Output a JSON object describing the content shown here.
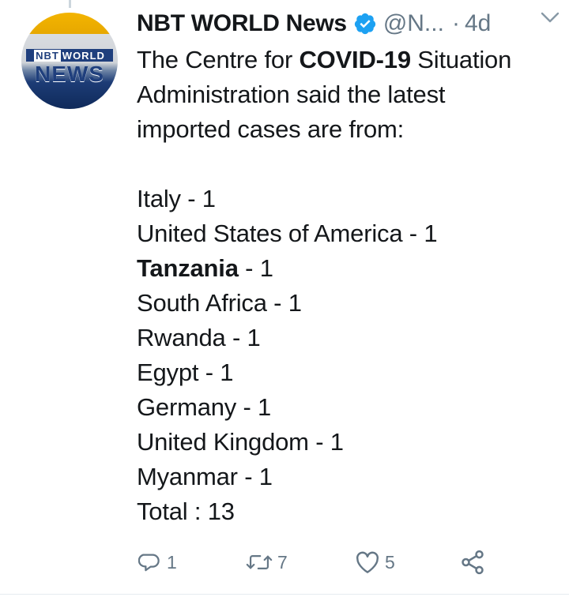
{
  "tweet": {
    "author_name": "NBT WORLD News",
    "handle": "@N...",
    "separator": "·",
    "time": "4d",
    "avatar": {
      "logo_top_a": "NBT",
      "logo_top_b": "WORLD",
      "logo_main": "NEWS"
    },
    "body": {
      "intro_1a": "The Centre for ",
      "intro_1b": "COVID-19",
      "intro_1c": " Situation",
      "intro_2": "Administration said the latest",
      "intro_3": "imported cases are from:",
      "countries": [
        {
          "name": "Italy",
          "suffix": " - 1"
        },
        {
          "name": "United States of America",
          "suffix": " - 1"
        },
        {
          "name": "Tanzania",
          "suffix": " - 1"
        },
        {
          "name": "South Africa",
          "suffix": " - 1"
        },
        {
          "name": "Rwanda",
          "suffix": " - 1"
        },
        {
          "name": "Egypt",
          "suffix": " - 1"
        },
        {
          "name": "Germany",
          "suffix": " - 1"
        },
        {
          "name": "United Kingdom",
          "suffix": " - 1"
        },
        {
          "name": "Myanmar",
          "suffix": " - 1"
        }
      ],
      "total": "Total : 13"
    },
    "actions": {
      "reply_count": "1",
      "retweet_count": "7",
      "like_count": "5"
    }
  },
  "icons": {
    "verified": "verified-badge-icon",
    "caret": "chevron-down-icon",
    "reply": "reply-icon",
    "retweet": "retweet-icon",
    "like": "heart-icon",
    "share": "share-icon"
  },
  "colors": {
    "text": "#14171a",
    "secondary": "#657786",
    "verified_blue": "#1da1f2"
  }
}
